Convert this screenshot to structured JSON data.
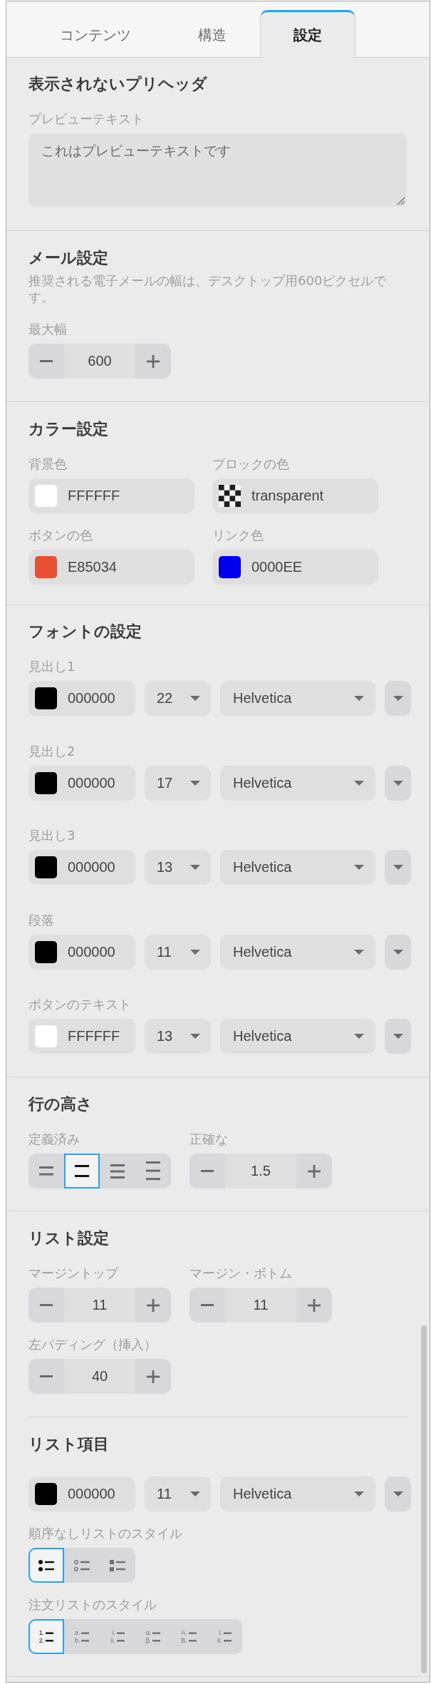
{
  "tabs": [
    {
      "label": "コンテンツ",
      "selected": false
    },
    {
      "label": "構造",
      "selected": false
    },
    {
      "label": "設定",
      "selected": true
    }
  ],
  "preheader": {
    "title": "表示されないプリヘッダ",
    "label": "プレビューテキスト",
    "value": "これはプレビューテキストです"
  },
  "email_settings": {
    "title": "メール設定",
    "description": "推奨される電子メールの幅は、デスクトップ用600ピクセルです。",
    "max_width": {
      "label": "最大幅",
      "value": "600"
    }
  },
  "color_settings": {
    "title": "カラー設定",
    "fields": [
      {
        "label": "背景色",
        "kind": "solid",
        "color": "#ffffff",
        "value": "FFFFFF"
      },
      {
        "label": "ブロックの色",
        "kind": "transparent",
        "value": "transparent"
      },
      {
        "label": "ボタンの色",
        "kind": "solid",
        "color": "#e85034",
        "value": "E85034"
      },
      {
        "label": "リンク色",
        "kind": "solid",
        "color": "#0000ee",
        "value": "0000EE"
      }
    ]
  },
  "font_settings": {
    "title": "フォントの設定",
    "rows": [
      {
        "label": "見出し1",
        "color": "#000000",
        "value": "000000",
        "size": "22",
        "family": "Helvetica"
      },
      {
        "label": "見出し2",
        "color": "#000000",
        "value": "000000",
        "size": "17",
        "family": "Helvetica"
      },
      {
        "label": "見出し3",
        "color": "#000000",
        "value": "000000",
        "size": "13",
        "family": "Helvetica"
      },
      {
        "label": "段落",
        "color": "#000000",
        "value": "000000",
        "size": "11",
        "family": "Helvetica"
      },
      {
        "label": "ボタンのテキスト",
        "color": "#ffffff",
        "value": "FFFFFF",
        "size": "13",
        "family": "Helvetica"
      }
    ]
  },
  "line_height": {
    "title": "行の高さ",
    "preset": {
      "label": "定義済み",
      "options": [
        {
          "kind": "compact",
          "selected": false
        },
        {
          "kind": "normal",
          "selected": true
        },
        {
          "kind": "relaxed",
          "selected": false
        },
        {
          "kind": "loose",
          "selected": false
        }
      ]
    },
    "exact": {
      "label": "正確な",
      "value": "1.5"
    }
  },
  "list_settings": {
    "title": "リスト設定",
    "steppers": [
      {
        "label": "マージントップ",
        "value": "11"
      },
      {
        "label": "マージン・ボトム",
        "value": "11"
      },
      {
        "label": "左パディング（挿入）",
        "value": "40"
      }
    ]
  },
  "list_item": {
    "title": "リスト項目",
    "font": {
      "color": "#000000",
      "value": "000000",
      "size": "11",
      "family": "Helvetica"
    },
    "unordered_style": {
      "label": "順序なしリストのスタイル",
      "options": [
        {
          "kind": "disc",
          "selected": true
        },
        {
          "kind": "circle",
          "selected": false
        },
        {
          "kind": "square",
          "selected": false
        }
      ]
    },
    "ordered_style": {
      "label": "注文リストのスタイル",
      "options": [
        {
          "markers": [
            "1.",
            "2."
          ],
          "selected": true
        },
        {
          "markers": [
            "a.",
            "b."
          ],
          "selected": false
        },
        {
          "markers": [
            "i.",
            "ii."
          ],
          "selected": false
        },
        {
          "markers": [
            "α.",
            "β."
          ],
          "selected": false
        },
        {
          "markers": [
            "A.",
            "B."
          ],
          "selected": false
        },
        {
          "markers": [
            "I.",
            "II."
          ],
          "selected": false
        }
      ]
    }
  }
}
